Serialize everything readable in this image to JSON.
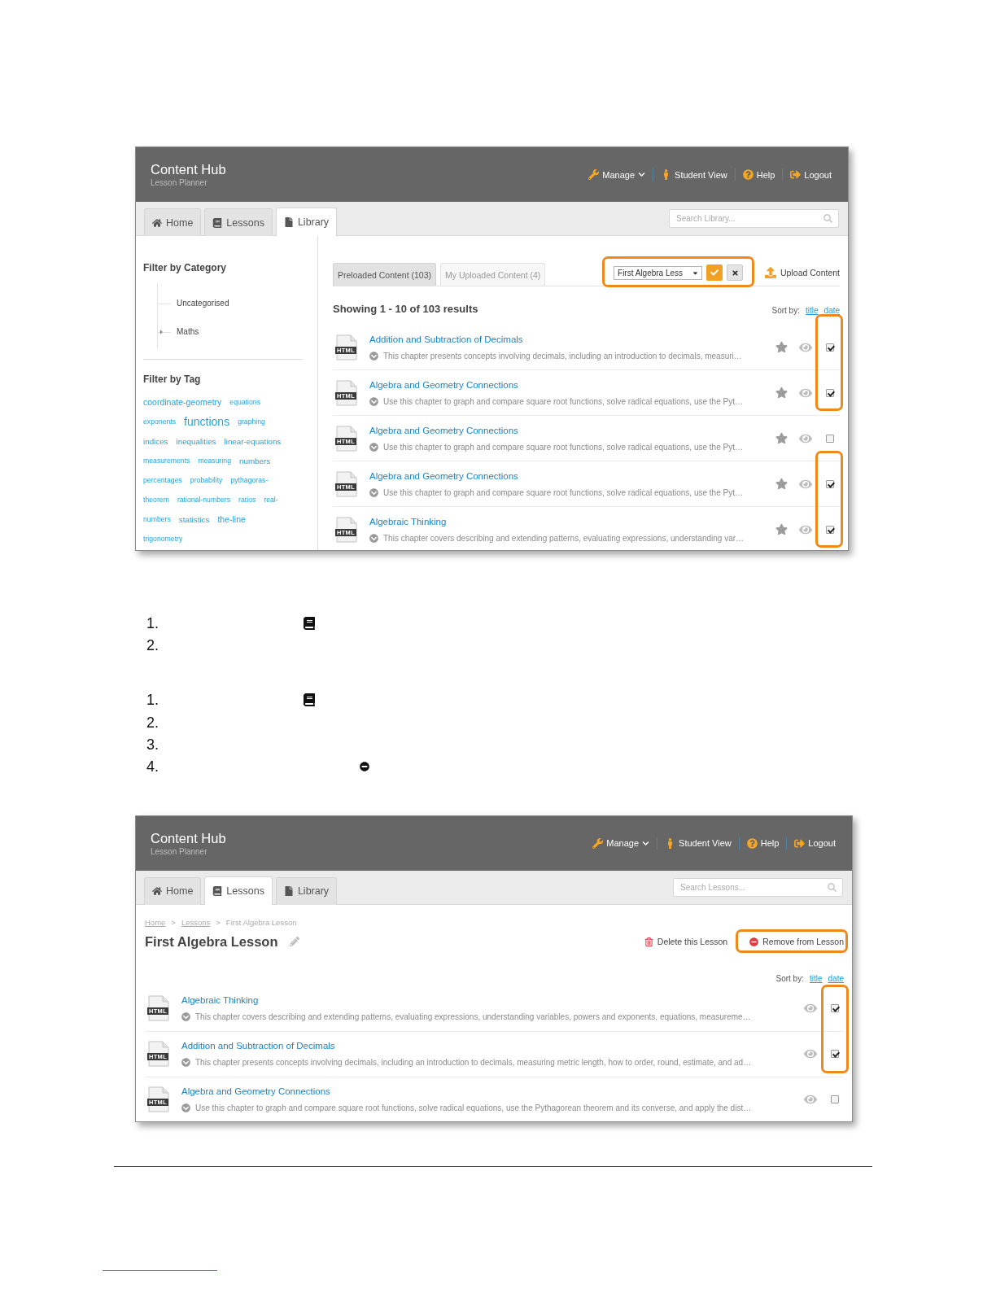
{
  "screenshot_1": {
    "header": {
      "title": "Content Hub",
      "subtitle": "Lesson Planner",
      "menu": [
        {
          "kind": "wrench",
          "label": "Manage",
          "dropdown": true
        },
        {
          "kind": "person",
          "label": "Student View",
          "dropdown": false
        },
        {
          "kind": "help",
          "label": "Help",
          "dropdown": false
        },
        {
          "kind": "logout",
          "label": "Logout",
          "dropdown": false
        }
      ]
    },
    "tabs": [
      {
        "kind": "home",
        "label": "Home",
        "selected": false
      },
      {
        "kind": "book",
        "label": "Lessons",
        "selected": false
      },
      {
        "kind": "file",
        "label": "Library",
        "selected": true
      }
    ],
    "search": {
      "placeholder": "Search Library..."
    },
    "sidebar": {
      "category_heading": "Filter by Category",
      "categories": [
        {
          "label": "Uncategorised",
          "expandable": false
        },
        {
          "label": "Maths",
          "expandable": true
        }
      ],
      "tag_heading": "Filter by Tag",
      "tag_rows": [
        [
          {
            "label": "coordinate-geometry",
            "kind": "large"
          },
          {
            "label": "equations",
            "kind": "small"
          }
        ],
        [
          {
            "label": "exponents",
            "kind": "small"
          },
          {
            "label": "functions",
            "kind": "xlarge"
          },
          {
            "label": "graphing",
            "kind": "small"
          }
        ],
        [
          {
            "label": "indices",
            "kind": "medium"
          },
          {
            "label": "inequalities",
            "kind": "medium"
          },
          {
            "label": "linear-equations",
            "kind": "medium"
          }
        ],
        [
          {
            "label": "measurements",
            "kind": "small"
          },
          {
            "label": "measuring",
            "kind": "small"
          },
          {
            "label": "numbers",
            "kind": "medium"
          }
        ],
        [
          {
            "label": "percentages",
            "kind": "small"
          },
          {
            "label": "probability",
            "kind": "small"
          },
          {
            "label": "pythagoras-",
            "kind": "small"
          }
        ],
        [
          {
            "label": "theorem",
            "kind": "small"
          },
          {
            "label": "rational-numbers",
            "kind": "small"
          },
          {
            "label": "ratios",
            "kind": "small"
          },
          {
            "label": "real-",
            "kind": "small"
          }
        ],
        [
          {
            "label": "numbers",
            "kind": "small"
          },
          {
            "label": "statistics",
            "kind": "medium"
          },
          {
            "label": "the-line",
            "kind": "large"
          }
        ],
        [
          {
            "label": "trigonometry",
            "kind": "small"
          }
        ]
      ]
    },
    "content_tabs": [
      {
        "label": "Preloaded Content (103)",
        "selected": true
      },
      {
        "label": "My Uploaded Content (4)",
        "selected": false
      }
    ],
    "lesson_picker": {
      "value": "First Algebra Less",
      "highlighted": true
    },
    "upload": {
      "label": "Upload Content"
    },
    "results_heading": "Showing 1 - 10 of 103 results",
    "sort": {
      "label": "Sort by:",
      "options": [
        "title",
        "date"
      ]
    },
    "rows": [
      {
        "file_type": "HTML",
        "title": "Addition and Subtraction of Decimals",
        "description": "This chapter presents concepts involving decimals, including an introduction to decimals, measuri…",
        "favorite": false,
        "checked": true,
        "highlighted": true
      },
      {
        "file_type": "HTML",
        "title": "Algebra and Geometry Connections",
        "description": "Use this chapter to graph and compare square root functions, solve radical equations, use the Pyt…",
        "favorite": false,
        "checked": true,
        "highlighted": true
      },
      {
        "file_type": "HTML",
        "title": "Algebra and Geometry Connections",
        "description": "Use this chapter to graph and compare square root functions, solve radical equations, use the Pyt…",
        "favorite": false,
        "checked": false,
        "highlighted": false
      },
      {
        "file_type": "HTML",
        "title": "Algebra and Geometry Connections",
        "description": "Use this chapter to graph and compare square root functions, solve radical equations, use the Pyt…",
        "favorite": false,
        "checked": true,
        "highlighted": true
      },
      {
        "file_type": "HTML",
        "title": "Algebraic Thinking",
        "description": "This chapter covers describing and extending patterns, evaluating expressions, understanding var…",
        "favorite": false,
        "checked": true,
        "highlighted": true
      }
    ]
  },
  "numbered_list_1": [
    {
      "number": "1.",
      "kind": "book"
    },
    {
      "number": "2.",
      "kind": "plain"
    }
  ],
  "numbered_list_2": [
    {
      "number": "1.",
      "kind": "book"
    },
    {
      "number": "2.",
      "kind": "plain"
    },
    {
      "number": "3.",
      "kind": "plain"
    },
    {
      "number": "4.",
      "kind": "minus-circle"
    }
  ],
  "screenshot_2": {
    "header": {
      "title": "Content Hub",
      "subtitle": "Lesson Planner",
      "menu": [
        {
          "kind": "wrench",
          "label": "Manage",
          "dropdown": true
        },
        {
          "kind": "person",
          "label": "Student View",
          "dropdown": false
        },
        {
          "kind": "help",
          "label": "Help",
          "dropdown": false
        },
        {
          "kind": "logout",
          "label": "Logout",
          "dropdown": false
        }
      ]
    },
    "tabs": [
      {
        "kind": "home",
        "label": "Home",
        "selected": false
      },
      {
        "kind": "book",
        "label": "Lessons",
        "selected": true
      },
      {
        "kind": "file",
        "label": "Library",
        "selected": false
      }
    ],
    "search": {
      "placeholder": "Search Lessons..."
    },
    "breadcrumb": [
      {
        "label": "Home",
        "kind": "link"
      },
      {
        "label": ">",
        "kind": "separator"
      },
      {
        "label": "Lessons",
        "kind": "link"
      },
      {
        "label": ">",
        "kind": "separator"
      },
      {
        "label": "First Algebra Lesson",
        "kind": "current"
      }
    ],
    "title": "First Algebra Lesson",
    "actions": [
      {
        "kind": "trash",
        "label": "Delete this Lesson",
        "highlighted": false
      },
      {
        "kind": "minus-circle",
        "label": "Remove from Lesson",
        "highlighted": true
      }
    ],
    "sort": {
      "label": "Sort by:",
      "options": [
        "title",
        "date"
      ]
    },
    "rows": [
      {
        "file_type": "HTML",
        "title": "Algebraic Thinking",
        "description": "This chapter covers describing and extending patterns, evaluating expressions, understanding variables, powers and exponents, equations, measureme…",
        "checked": true,
        "highlighted": true
      },
      {
        "file_type": "HTML",
        "title": "Addition and Subtraction of Decimals",
        "description": "This chapter presents concepts involving decimals, including an introduction to decimals, measuring metric length, how to order, round, estimate, and ad…",
        "checked": true,
        "highlighted": true
      },
      {
        "file_type": "HTML",
        "title": "Algebra and Geometry Connections",
        "description": "Use this chapter to graph and compare square root functions, solve radical equations, use the Pythagorean theorem and its converse, and apply the dist…",
        "checked": false,
        "highlighted": false
      }
    ]
  }
}
